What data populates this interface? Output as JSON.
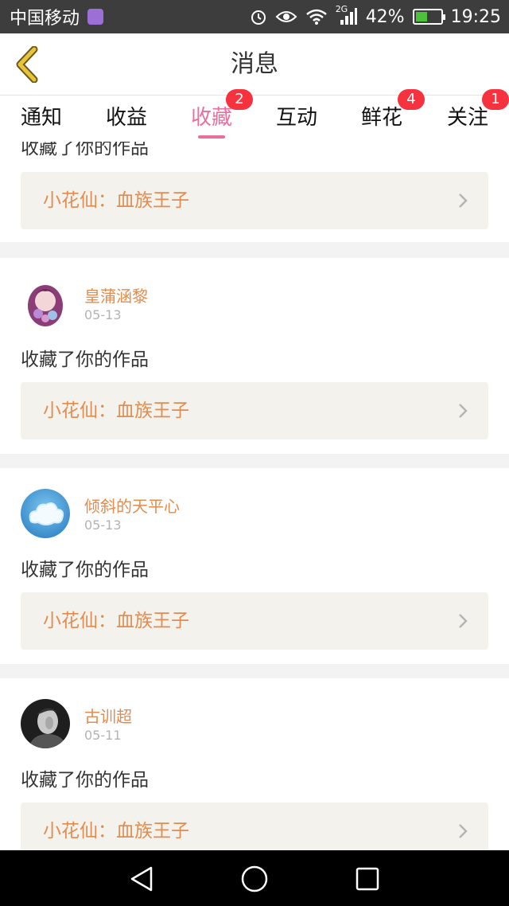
{
  "status_bar": {
    "carrier": "中国移动",
    "network": "2G",
    "battery": "42%",
    "time": "19:25"
  },
  "header": {
    "title": "消息"
  },
  "tabs": [
    {
      "label": "通知",
      "badge": ""
    },
    {
      "label": "收益",
      "badge": ""
    },
    {
      "label": "收藏",
      "badge": "2"
    },
    {
      "label": "互动",
      "badge": ""
    },
    {
      "label": "鲜花",
      "badge": "4"
    },
    {
      "label": "关注",
      "badge": "1"
    }
  ],
  "feed": {
    "partial_text": "收藏了你的作品",
    "partial_work": "小花仙：血族王子",
    "items": [
      {
        "user": "皇蒲涵黎",
        "date": "05-13",
        "text": "收藏了你的作品",
        "work": "小花仙：血族王子"
      },
      {
        "user": "倾斜的天平心",
        "date": "05-13",
        "text": "收藏了你的作品",
        "work": "小花仙：血族王子"
      },
      {
        "user": "古训超",
        "date": "05-11",
        "text": "收藏了你的作品",
        "work": "小花仙：血族王子"
      }
    ]
  },
  "colors": {
    "accent": "#e86f9e",
    "badge": "#f5323e",
    "username": "#e38c50",
    "back_icon": "#e7c43a"
  }
}
